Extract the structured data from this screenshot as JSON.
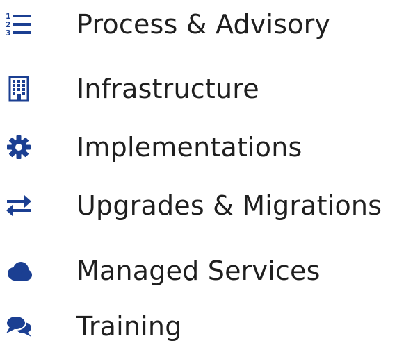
{
  "accent_color": "#1b3f92",
  "text_color": "#1f1f1f",
  "menu": {
    "items": [
      {
        "label": "Process & Advisory",
        "icon": "numbered-list-icon"
      },
      {
        "label": "Infrastructure",
        "icon": "building-icon"
      },
      {
        "label": "Implementations",
        "icon": "gear-icon"
      },
      {
        "label": "Upgrades & Migrations",
        "icon": "exchange-arrows-icon"
      },
      {
        "label": "Managed Services",
        "icon": "cloud-icon"
      },
      {
        "label": "Training",
        "icon": "chat-bubbles-icon"
      }
    ]
  }
}
